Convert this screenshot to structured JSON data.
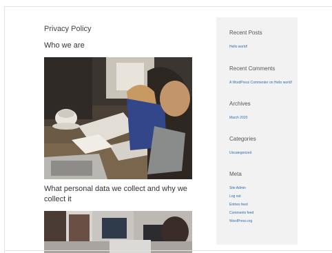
{
  "main": {
    "page_title": "Privacy Policy",
    "heading_who": "Who we are",
    "heading_data": "What personal data we collect and why we collect it"
  },
  "sidebar": {
    "recent_posts": {
      "title": "Recent Posts",
      "items": [
        "Hello world!"
      ]
    },
    "recent_comments": {
      "title": "Recent Comments",
      "items": [
        "A WordPress Commenter on Hello world!"
      ]
    },
    "archives": {
      "title": "Archives",
      "items": [
        "March 2020"
      ]
    },
    "categories": {
      "title": "Categories",
      "items": [
        "Uncategorized"
      ]
    },
    "meta": {
      "title": "Meta",
      "items": [
        "Site Admin",
        "Log out",
        "Entries feed",
        "Comments feed",
        "WordPress.org"
      ]
    }
  }
}
